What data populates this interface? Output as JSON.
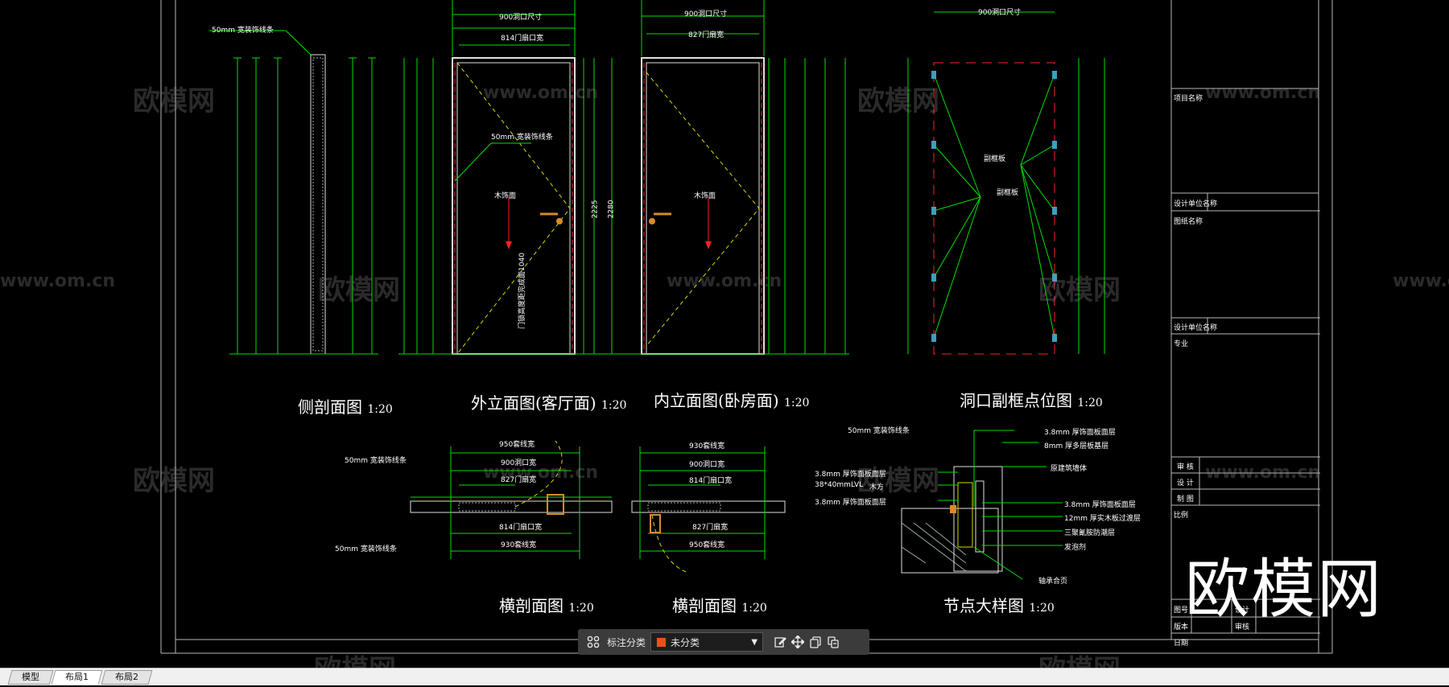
{
  "drawing": {
    "views": {
      "side_section": {
        "title": "侧剖面图",
        "scale": "1:20"
      },
      "outer_elevation": {
        "title": "外立面图(客厅面)",
        "scale": "1:20"
      },
      "inner_elevation": {
        "title": "内立面图(卧房面)",
        "scale": "1:20"
      },
      "subframe_points": {
        "title": "洞口副框点位图",
        "scale": "1:20"
      },
      "cross_section_a": {
        "title": "横剖面图",
        "scale": "1:20"
      },
      "cross_section_b": {
        "title": "横剖面图",
        "scale": "1:20"
      },
      "node_detail": {
        "title": "节点大样图",
        "scale": "1:20"
      }
    },
    "dims": {
      "top_a": "950套线宽",
      "top_b": "900洞口尺寸",
      "top_c": "814门扇口宽",
      "top_d": "900洞口尺寸",
      "top_e": "827门扇宽",
      "top_f": "900洞口尺寸",
      "side_left": "50mm 宽装饰线条",
      "door_note": "50mm 宽装饰线条",
      "wood_grain_1": "木饰面",
      "wood_grain_2": "木饰面",
      "h_2225": "2225",
      "h_2280": "2280",
      "subframe_1": "副框板",
      "subframe_2": "副框板",
      "hw_height": "门锁高度距完成面1040"
    },
    "cross_a": {
      "top1": "950套线宽",
      "top2": "900洞口宽",
      "top3": "827门扇宽",
      "bot1": "814门扇口宽",
      "bot2": "930套线宽",
      "note1": "50mm 宽装饰线条",
      "note2": "50mm 宽装饰线条"
    },
    "cross_b": {
      "top1": "930套线宽",
      "top2": "900洞口宽",
      "top3": "814门扇口宽",
      "bot1": "827门扇宽",
      "bot2": "950套线宽"
    },
    "node": {
      "n1": "50mm 宽装饰线条",
      "n2": "3.8mm 厚饰面板面层",
      "n3": "8mm 厚多层板基层",
      "n4": "原建筑墙体",
      "n5": "3.8mm 厚饰面板面层",
      "n6": "38*40mmLVL",
      "n7": "木方",
      "n8": "3.8mm 厚饰面板面层",
      "n9": "3.8mm 厚饰面板面层",
      "n10": "12mm 厚实木板过渡层",
      "n11": "三聚氰胺防潮层",
      "n12": "发泡剂",
      "n13": "轴承合页"
    },
    "title_block": {
      "r1": "项目名称",
      "r2": "图纸名称",
      "r3": "设计单位名称",
      "r4": "设计单位名称",
      "r5": "专业",
      "r6": "日期",
      "r7": "比例",
      "r8": "审 核",
      "r9": "设 计",
      "r10": "制 图",
      "r11": "图号",
      "r12": "版本",
      "r13": "设计",
      "r14": "审核"
    },
    "watermarks": [
      "欧模网",
      "www.om.cn"
    ],
    "logo_text": "欧模网"
  },
  "toolbar": {
    "label": "标注分类",
    "selected": "未分类",
    "swatch_color": "#e8521a",
    "icons": [
      "grid-icon",
      "edit-icon",
      "move-icon",
      "copy-icon",
      "paste-icon"
    ]
  },
  "tabs": [
    {
      "label": "模型",
      "active": false
    },
    {
      "label": "布局1",
      "active": true
    },
    {
      "label": "布局2",
      "active": false
    }
  ]
}
